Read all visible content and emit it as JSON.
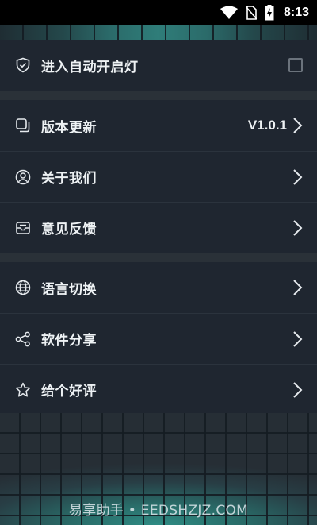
{
  "status_bar": {
    "time": "8:13",
    "icons": [
      "wifi-icon",
      "no-sim-icon",
      "battery-charging-icon"
    ]
  },
  "auto_light": {
    "label": "进入自动开启灯",
    "checked": false,
    "icon": "shield-check-icon"
  },
  "menu_groups": [
    {
      "items": [
        {
          "label": "版本更新",
          "value": "V1.0.1",
          "icon": "copy-icon"
        },
        {
          "label": "关于我们",
          "icon": "user-circle-icon"
        },
        {
          "label": "意见反馈",
          "icon": "mail-tray-icon"
        }
      ]
    },
    {
      "items": [
        {
          "label": "语言切换",
          "icon": "globe-icon"
        },
        {
          "label": "软件分享",
          "icon": "share-icon"
        },
        {
          "label": "给个好评",
          "icon": "star-icon"
        }
      ]
    }
  ],
  "watermark": "易享助手 • EEDSHZJZ.COM"
}
